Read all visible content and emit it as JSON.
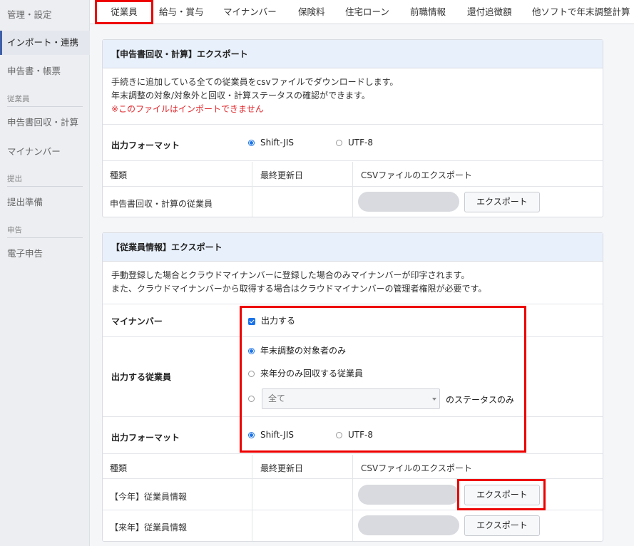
{
  "sidebar": {
    "items": [
      {
        "label": "管理・設定"
      },
      {
        "label": "インポート・連携"
      },
      {
        "label": "申告書・帳票"
      },
      {
        "label": "申告書回収・計算"
      },
      {
        "label": "マイナンバー"
      },
      {
        "label": "提出準備"
      },
      {
        "label": "電子申告"
      }
    ],
    "sections": [
      {
        "label": "従業員"
      },
      {
        "label": "提出"
      },
      {
        "label": "申告"
      }
    ]
  },
  "tabs": [
    {
      "label": "従業員"
    },
    {
      "label": "給与・賞与"
    },
    {
      "label": "マイナンバー"
    },
    {
      "label": "保険料"
    },
    {
      "label": "住宅ローン"
    },
    {
      "label": "前職情報"
    },
    {
      "label": "還付追徴額"
    },
    {
      "label": "他ソフトで年末調整計算"
    }
  ],
  "panel1": {
    "title": "【申告書回収・計算】エクスポート",
    "desc_line1": "手続きに追加している全ての従業員をcsvファイルでダウンロードします。",
    "desc_line2": "年末調整の対象/対象外と回収・計算ステータスの確認ができます。",
    "warning": "※このファイルはインポートできません",
    "format_label": "出力フォーマット",
    "format_options": [
      "Shift-JIS",
      "UTF-8"
    ],
    "format_selected": "Shift-JIS",
    "table_headers": [
      "種類",
      "最終更新日",
      "CSVファイルのエクスポート"
    ],
    "rows": [
      {
        "type": "申告書回収・計算の従業員",
        "updated": "",
        "button": "エクスポート"
      }
    ]
  },
  "panel2": {
    "title": "【従業員情報】エクスポート",
    "desc_line1": "手動登録した場合とクラウドマイナンバーに登録した場合のみマイナンバーが印字されます。",
    "desc_line2": "また、クラウドマイナンバーから取得する場合はクラウドマイナンバーの管理者権限が必要です。",
    "mynumber_label": "マイナンバー",
    "mynumber_option": "出力する",
    "mynumber_checked": true,
    "employees_label": "出力する従業員",
    "employee_options": [
      "年末調整の対象者のみ",
      "来年分のみ回収する従業員"
    ],
    "employee_selected": "年末調整の対象者のみ",
    "status_select_value": "全て",
    "status_suffix": "のステータスのみ",
    "format_label": "出力フォーマット",
    "format_options": [
      "Shift-JIS",
      "UTF-8"
    ],
    "format_selected": "Shift-JIS",
    "table_headers": [
      "種類",
      "最終更新日",
      "CSVファイルのエクスポート"
    ],
    "rows": [
      {
        "type": "【今年】従業員情報",
        "updated": "",
        "button": "エクスポート"
      },
      {
        "type": "【来年】従業員情報",
        "updated": "",
        "button": "エクスポート"
      }
    ]
  },
  "colors": {
    "accent": "#1a73e8",
    "highlight": "#e00000",
    "warning": "#e0262b",
    "panel_header": "#e8f0fb"
  }
}
